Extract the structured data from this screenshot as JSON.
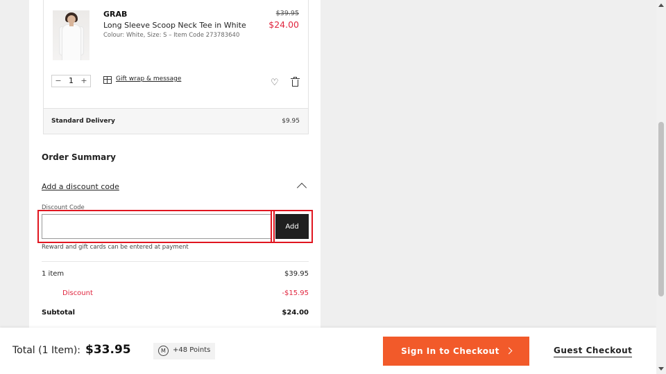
{
  "cart_item": {
    "brand": "GRAB",
    "name": "Long Sleeve Scoop Neck Tee in White",
    "meta": "Colour: White, Size: S – Item Code 273783640",
    "was_price": "$39.95",
    "price": "$24.00",
    "quantity": "1",
    "gift_label": "Gift wrap & message"
  },
  "delivery": {
    "label": "Standard Delivery",
    "price": "$9.95"
  },
  "order_summary": {
    "title": "Order Summary",
    "discount_toggle": "Add a discount code",
    "discount_label": "Discount Code",
    "discount_value": "",
    "add_button": "Add",
    "note": "Reward and gift cards can be entered at payment",
    "items_label": "1 item",
    "items_value": "$39.95",
    "discount_row_label": "Discount",
    "discount_row_value": "-$15.95",
    "subtotal_label": "Subtotal",
    "subtotal_value": "$24.00"
  },
  "footer": {
    "total_label": "Total (1 Item):",
    "total_value": "$33.95",
    "points_badge": "M",
    "points": "+48 Points",
    "signin_button": "Sign In to Checkout",
    "guest_button": "Guest Checkout"
  },
  "colors": {
    "accent": "#f25a2a",
    "sale": "#e0243d",
    "highlight": "#e0151f"
  }
}
